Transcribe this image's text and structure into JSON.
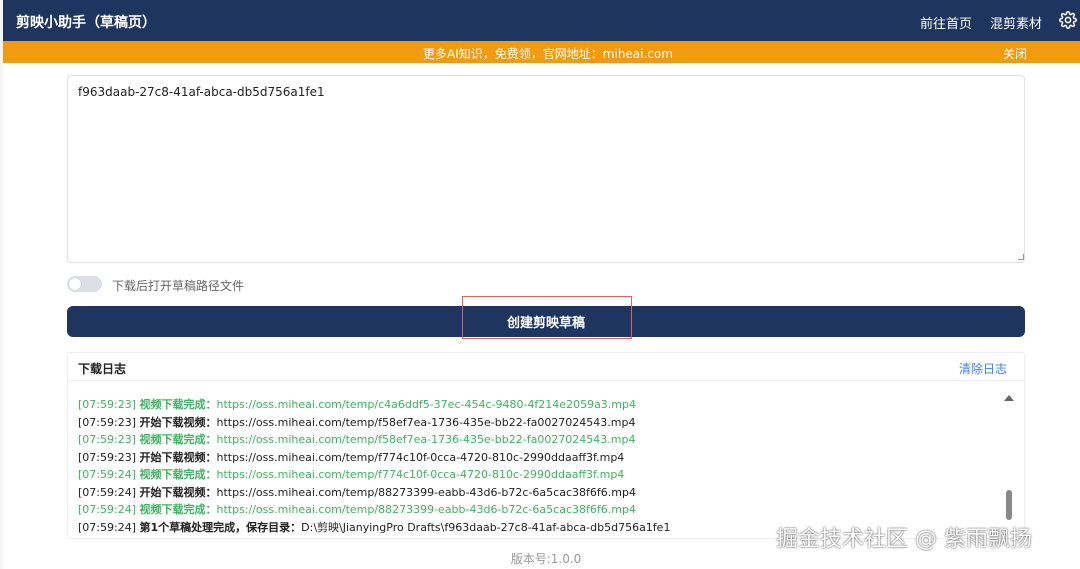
{
  "header": {
    "title": "剪映小助手（草稿页）",
    "nav_home": "前往首页",
    "nav_mix": "混剪素材",
    "settings_icon": "gear-icon"
  },
  "banner": {
    "text": "更多AI知识，免费领，官网地址：miheai.com",
    "close_label": "关闭",
    "color": "#f39a0f"
  },
  "draft_input": {
    "value": "f963daab-27c8-41af-abca-db5d756a1fe1"
  },
  "toggle": {
    "label": "下载后打开草稿路径文件",
    "checked": false
  },
  "create_button": {
    "label": "创建剪映草稿"
  },
  "log": {
    "title": "下载日志",
    "clear_label": "清除日志",
    "lines": [
      {
        "time": "[07:59:23]",
        "label": "视频下载完成：",
        "url": "https://oss.miheai.com/temp/c4a6ddf5-37ec-454c-9480-4f214e2059a3.mp4",
        "status": "success"
      },
      {
        "time": "[07:59:23]",
        "label": "开始下载视频：",
        "url": "https://oss.miheai.com/temp/f58ef7ea-1736-435e-bb22-fa0027024543.mp4",
        "status": "info"
      },
      {
        "time": "[07:59:23]",
        "label": "视频下载完成：",
        "url": "https://oss.miheai.com/temp/f58ef7ea-1736-435e-bb22-fa0027024543.mp4",
        "status": "success"
      },
      {
        "time": "[07:59:23]",
        "label": "开始下载视频：",
        "url": "https://oss.miheai.com/temp/f774c10f-0cca-4720-810c-2990ddaaff3f.mp4",
        "status": "info"
      },
      {
        "time": "[07:59:24]",
        "label": "视频下载完成：",
        "url": "https://oss.miheai.com/temp/f774c10f-0cca-4720-810c-2990ddaaff3f.mp4",
        "status": "success"
      },
      {
        "time": "[07:59:24]",
        "label": "开始下载视频：",
        "url": "https://oss.miheai.com/temp/88273399-eabb-43d6-b72c-6a5cac38f6f6.mp4",
        "status": "info"
      },
      {
        "time": "[07:59:24]",
        "label": "视频下载完成：",
        "url": "https://oss.miheai.com/temp/88273399-eabb-43d6-b72c-6a5cac38f6f6.mp4",
        "status": "success"
      },
      {
        "time": "[07:59:24]",
        "label": "第1个草稿处理完成，保存目录：",
        "url": "D:\\剪映\\JianyingPro Drafts\\f963daab-27c8-41af-abca-db5d756a1fe1",
        "status": "info"
      }
    ]
  },
  "footer": {
    "version": "版本号:1.0.0"
  },
  "watermark": "掘金技术社区 @ 紫雨飘扬",
  "colors": {
    "header_bg": "#1e3560",
    "success": "#3db460",
    "link": "#3b82f6"
  }
}
